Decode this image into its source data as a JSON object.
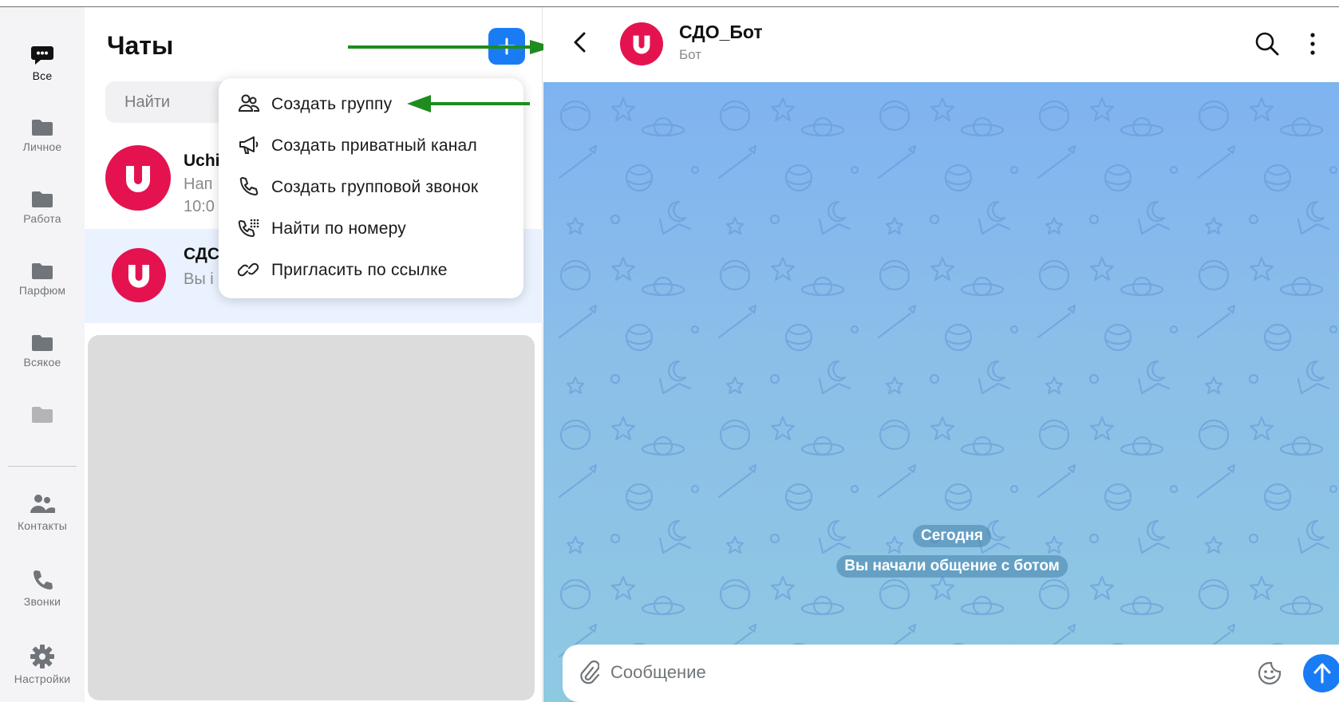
{
  "sidebar": {
    "items": [
      {
        "label": "Все",
        "icon": "chat-bubble-icon",
        "active": true
      },
      {
        "label": "Личное",
        "icon": "folder-icon"
      },
      {
        "label": "Работа",
        "icon": "folder-icon"
      },
      {
        "label": "Парфюм",
        "icon": "folder-icon"
      },
      {
        "label": "Всякое",
        "icon": "folder-icon"
      },
      {
        "label": "",
        "icon": "folder-icon"
      }
    ],
    "bottom_items": [
      {
        "label": "Контакты",
        "icon": "contacts-icon"
      },
      {
        "label": "Звонки",
        "icon": "phone-icon"
      },
      {
        "label": "Настройки",
        "icon": "gear-icon"
      }
    ]
  },
  "chat_list": {
    "title": "Чаты",
    "search_placeholder": "Найти",
    "chats": [
      {
        "name": "Uchi",
        "preview": "Нап",
        "time": "10:0"
      },
      {
        "name": "СДС",
        "preview": "Вы і",
        "selected": true
      }
    ]
  },
  "menu": {
    "items": [
      {
        "label": "Создать группу",
        "icon": "group-icon"
      },
      {
        "label": "Создать приватный канал",
        "icon": "megaphone-icon"
      },
      {
        "label": "Создать групповой звонок",
        "icon": "phone-icon"
      },
      {
        "label": "Найти по номеру",
        "icon": "dialpad-icon"
      },
      {
        "label": "Пригласить по ссылке",
        "icon": "link-icon"
      }
    ]
  },
  "chat": {
    "name": "СДО_Бот",
    "subtitle": "Бот",
    "date_label": "Сегодня",
    "system_message": "Вы начали общение с ботом",
    "composer_placeholder": "Сообщение"
  },
  "colors": {
    "accent": "#1a7cf5",
    "avatar": "#e4134f",
    "annotation_arrow": "#1e8c1e",
    "wallpaper_top": "#7fb3f0",
    "wallpaper_bottom": "#8ec9e2"
  }
}
